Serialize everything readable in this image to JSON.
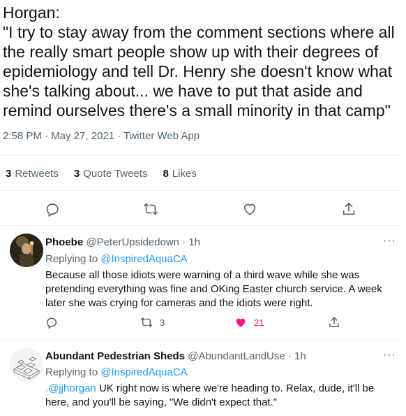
{
  "tweet": {
    "text": "Horgan:\n\"I try to stay away from the comment sections where all the really smart people show up with their degrees of epidemiology and tell Dr. Henry she doesn't know what she's talking about... we have to put that aside and remind ourselves there's a small minority in that camp\"",
    "meta": "2:58 PM · May 27, 2021 · Twitter Web App",
    "stats": {
      "retweets_count": "3",
      "retweets_label": "Retweets",
      "quotes_count": "3",
      "quotes_label": "Quote Tweets",
      "likes_count": "8",
      "likes_label": "Likes"
    }
  },
  "replies": [
    {
      "name": "Phoebe",
      "handle": "@PeterUpsidedown · 1h",
      "replying_prefix": "Replying to",
      "replying_to": "@InspiredAquaCA",
      "body": "Because all those idiots were warning of a third wave while she was pretending everything was fine and OKing Easter church service.  A week later she was crying for cameras and the idiots were right.",
      "retweets": "3",
      "likes": "21",
      "liked": true
    },
    {
      "name": "Abundant Pedestrian Sheds",
      "handle": "@AbundantLandUse · 1h",
      "replying_prefix": "Replying to",
      "replying_to": "@InspiredAquaCA",
      "mention": ".@jjhorgan",
      "body": " UK right now is where we're heading to. Relax, dude, it'll be here, and you'll be saying, \"We didn't expect that.\""
    }
  ],
  "more_label": "···",
  "colors": {
    "accent": "#1d9bf0",
    "like": "#f91880",
    "muted": "#536471"
  },
  "icons": [
    "reply-icon",
    "retweet-icon",
    "like-icon",
    "share-icon",
    "more-icon"
  ]
}
